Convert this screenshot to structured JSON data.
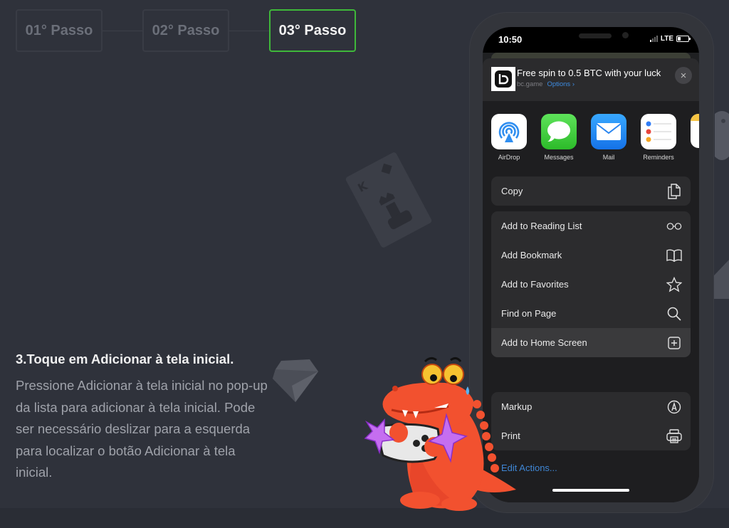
{
  "stepper": {
    "steps": [
      {
        "label": "01° Passo",
        "active": false
      },
      {
        "label": "02° Passo",
        "active": false
      },
      {
        "label": "03° Passo",
        "active": true
      }
    ],
    "active_color": "#3fb83a"
  },
  "instruction": {
    "title": "3.Toque em Adicionar à tela inicial.",
    "body": "Pressione Adicionar à tela inicial no pop-up da lista para adicionar à tela inicial. Pode ser necessário deslizar para a esquerda para localizar o botão Adicionar à tela inicial."
  },
  "phone": {
    "status_bar": {
      "time": "10:50",
      "network": "LTE"
    },
    "share_sheet": {
      "site_title": "Free spin to 0.5 BTC with your luck",
      "site_domain": "bc.game",
      "options_label": "Options",
      "options_chevron": "›",
      "close_icon": "×",
      "apps": [
        {
          "label": "AirDrop",
          "icon": "airdrop-icon"
        },
        {
          "label": "Messages",
          "icon": "messages-icon"
        },
        {
          "label": "Mail",
          "icon": "mail-icon"
        },
        {
          "label": "Reminders",
          "icon": "reminders-icon"
        }
      ],
      "group1": [
        {
          "label": "Copy",
          "icon": "copy-icon"
        }
      ],
      "group2": [
        {
          "label": "Add to Reading List",
          "icon": "glasses-icon"
        },
        {
          "label": "Add Bookmark",
          "icon": "book-icon"
        },
        {
          "label": "Add to Favorites",
          "icon": "star-icon"
        },
        {
          "label": "Find on Page",
          "icon": "search-icon"
        },
        {
          "label": "Add to Home Screen",
          "icon": "plus-square-icon",
          "highlighted": true
        }
      ],
      "group3": [
        {
          "label": "Markup",
          "icon": "markup-icon"
        },
        {
          "label": "Print",
          "icon": "printer-icon"
        }
      ],
      "edit_actions_label": "Edit Actions..."
    }
  },
  "colors": {
    "background": "#2f323b",
    "link_blue": "#3f86d4",
    "mascot_red": "#f2512f"
  }
}
